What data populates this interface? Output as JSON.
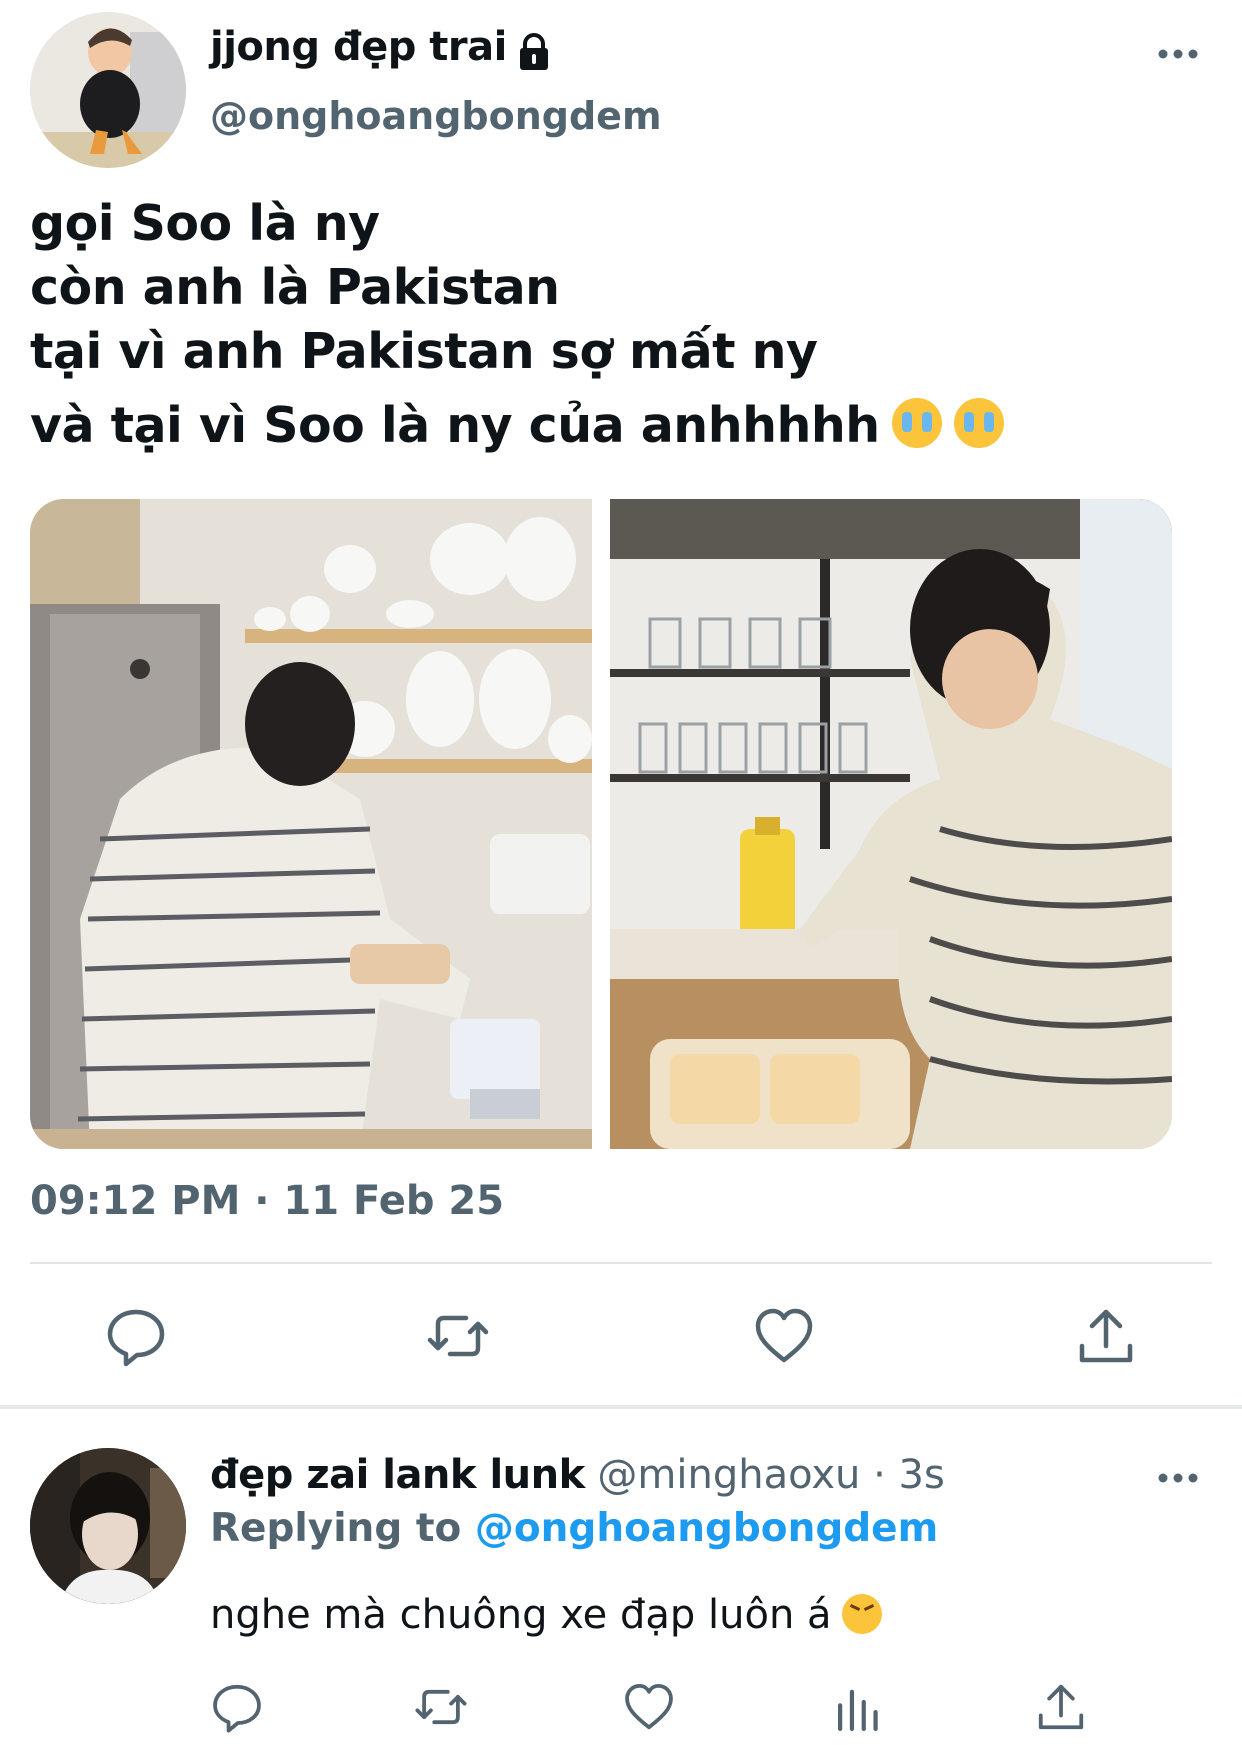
{
  "tweet": {
    "author_name": "jjong đẹp trai",
    "author_handle": "@onghoangbongdem",
    "lines": [
      "gọi Soo là ny",
      "còn anh là Pakistan",
      "tại vì anh Pakistan sợ mất ny",
      "và tại vì Soo là ny của anhhhhh"
    ],
    "timestamp": "09:12 PM · 11 Feb 25",
    "icons": [
      "lock-icon",
      "more-icon",
      "loudly-crying-emoji",
      "reply-icon",
      "retweet-icon",
      "like-icon",
      "share-icon"
    ]
  },
  "reply": {
    "author_name": "đẹp zai lank lunk",
    "meta": "@minghaoxu · 3s",
    "replying_label": "Replying to",
    "replying_handle": "@onghoangbongdem",
    "text": "nghe mà chuông xe đạp luôn á",
    "icons": [
      "more-icon",
      "confounded-emoji",
      "reply-icon",
      "retweet-icon",
      "like-icon",
      "analytics-icon",
      "share-icon"
    ]
  },
  "colors": {
    "text": "#0f1419",
    "secondary": "#536471",
    "link": "#1d9bf0",
    "divider": "#e1e5e8"
  }
}
